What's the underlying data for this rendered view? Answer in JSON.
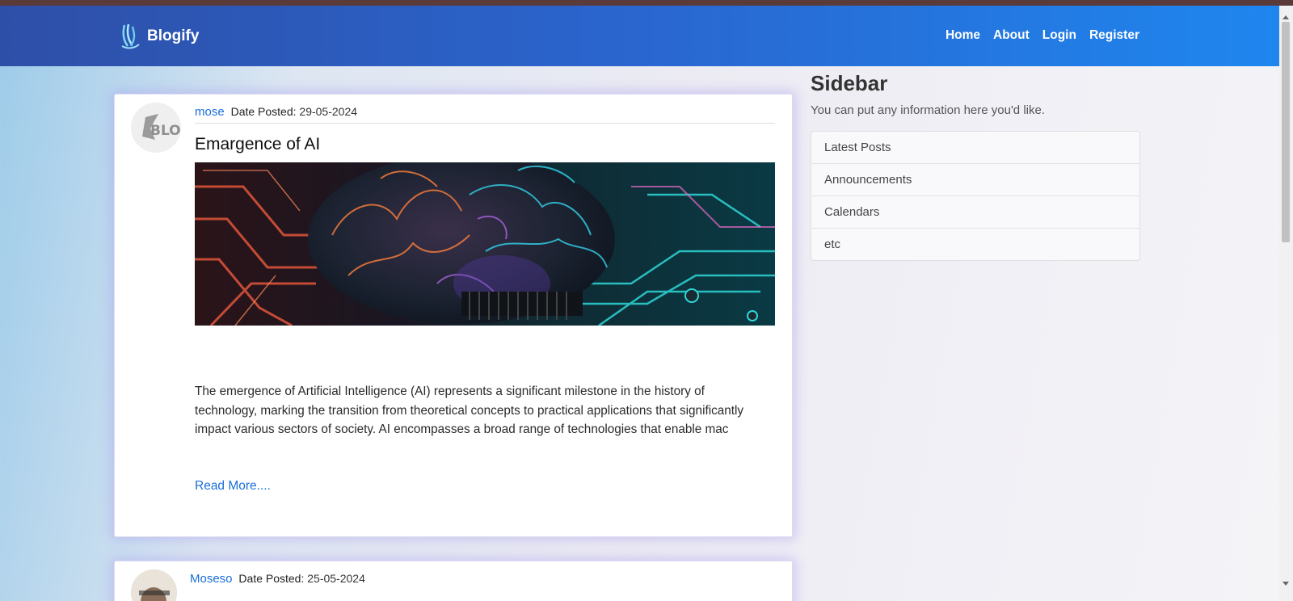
{
  "brand": {
    "name": "Blogify"
  },
  "nav": {
    "links": [
      "Home",
      "About",
      "Login",
      "Register"
    ]
  },
  "posts": [
    {
      "author": "mose",
      "date_label": "Date Posted:",
      "date": "29-05-2024",
      "title": "Emargence of AI",
      "excerpt": "The emergence of Artificial Intelligence (AI) represents a significant milestone in the history of technology, marking the transition from theoretical concepts to practical applications that significantly impact various sectors of society. AI encompasses a broad range of technologies that enable mac",
      "read_more": "Read More....",
      "avatar_text": "BLO"
    },
    {
      "author": "Moseso",
      "date_label": "Date Posted:",
      "date": "25-05-2024"
    }
  ],
  "sidebar": {
    "title": "Sidebar",
    "text": "You can put any information here you'd like.",
    "items": [
      "Latest Posts",
      "Announcements",
      "Calendars",
      "etc"
    ]
  },
  "colors": {
    "nav_start": "#2e4fa8",
    "nav_end": "#1f86ef",
    "link": "#1a6fd8",
    "card_glow": "#aaa0f0"
  }
}
